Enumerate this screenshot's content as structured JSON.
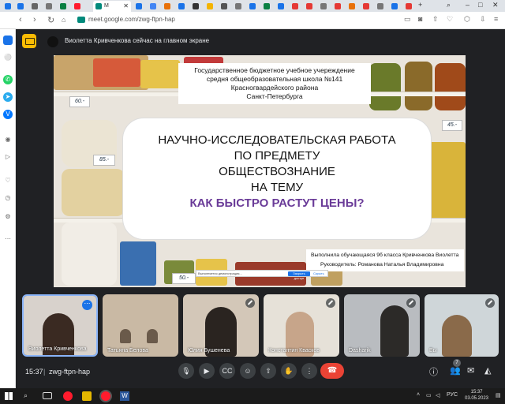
{
  "browser": {
    "active_tab": "M",
    "url": "meet.google.com/zwg-ftpn-hap",
    "colors": {
      "opera_red": "#ff1b2d",
      "tab_bg": "#dfe3e8"
    }
  },
  "presenting": {
    "text": "Виолетта Кривченкова сейчас на главном экране"
  },
  "slide": {
    "school_lines": [
      "Государственное бюджетное учебное учереждение",
      "средня общеобразовательная школа №141",
      "Красногвардейского района",
      "Санкт-Петербурга"
    ],
    "title_lines": [
      "НАУЧНО-ИССЛЕДОВАТЕЛЬСКАЯ РАБОТА",
      "ПО ПРЕДМЕТУ",
      "ОБЩЕСТВОЗНАНИЕ",
      "НА ТЕМУ"
    ],
    "question": "КАК БЫСТРО РАСТУТ ЦЕНЫ?",
    "author_line1": "Выполнила обучающаяся 9б класса Кривченкова Виолетта",
    "author_line2": "Руководитель: Романова Наталья Владимировна",
    "price_tags": [
      "60.-",
      "85.-",
      "45.-",
      "50.-"
    ],
    "share_bar": {
      "text": "Выполняется демонстрация...",
      "stop_label": "Закрыть доступ",
      "hide_label": "Скрыть"
    }
  },
  "participants": [
    {
      "name": "Виолетта Кривченкова",
      "muted": false,
      "active": true,
      "colors": [
        "#d8d2cc",
        "#3a2a22"
      ]
    },
    {
      "name": "Татьяна Белова",
      "muted": false,
      "active": false,
      "colors": [
        "#c9b9a4",
        "#6a5a4a"
      ]
    },
    {
      "name": "Юлия Бушенева",
      "muted": true,
      "active": false,
      "colors": [
        "#d3c7b8",
        "#2a2420"
      ]
    },
    {
      "name": "Константин Квасков",
      "muted": true,
      "active": false,
      "colors": [
        "#e6e1d8",
        "#c7a58a"
      ]
    },
    {
      "name": "Dasharik",
      "muted": true,
      "active": false,
      "colors": [
        "#b9bcc0",
        "#2c2a28"
      ]
    },
    {
      "name": "Вы",
      "muted": true,
      "active": false,
      "colors": [
        "#cfd6d9",
        "#8a6a4a"
      ]
    }
  ],
  "controls": {
    "time": "15:37",
    "meeting_code": "zwg-ftpn-hap",
    "participant_count": "7"
  },
  "taskbar": {
    "lang": "РУС",
    "clock_time": "15:37",
    "clock_date": "03.05.2023"
  }
}
